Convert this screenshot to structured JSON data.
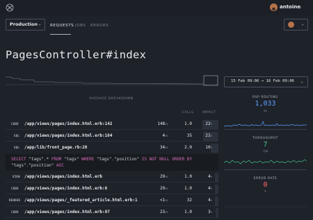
{
  "header": {
    "user_name": "antoine",
    "colors": {
      "bg": "#1c2026",
      "avatar": "#b5734a"
    }
  },
  "environment": {
    "selected": "Production"
  },
  "tabs": [
    {
      "label": "REQUESTS",
      "active": true
    },
    {
      "label": "JOBS",
      "active": false
    },
    {
      "label": "ERRORS",
      "active": false
    }
  ],
  "page_title": "PagesController#index",
  "date_range": {
    "label": "15 Feb 09:06 → 16 Feb 09:06"
  },
  "breakdown": {
    "title": "AVERAGE BREAKDOWN",
    "columns": {
      "calls": "CALLS",
      "impact": "IMPACT"
    },
    "rows": [
      {
        "tag": "CODE",
        "path": "/app/views/pages/index.html.erb:142",
        "time": "148",
        "unit": "ms",
        "calls": "1.0",
        "impact": "22",
        "impact_unit": "%"
      },
      {
        "tag": "SQL",
        "path": "/app/views/pages/index.html.erb:164",
        "time": "4",
        "unit": "ms",
        "calls": "35",
        "impact": "21",
        "impact_unit": "%"
      },
      {
        "tag": "SQL",
        "path": "/app/lib/front_page.rb:20",
        "time": "34",
        "unit": "ms",
        "calls": "2.0",
        "impact": "10",
        "impact_unit": "%"
      },
      {
        "tag": "VIEW",
        "path": "/app/views/pages/index.html.erb",
        "time": "29",
        "unit": "ms",
        "calls": "1.0",
        "impact": "4",
        "impact_unit": "%"
      },
      {
        "tag": "CODE",
        "path": "/app/views/pages/index.html.erb:6",
        "time": "29",
        "unit": "ms",
        "calls": "1.0",
        "impact": "4",
        "impact_unit": "%"
      },
      {
        "tag": "RENDER",
        "path": "/app/views/pages/_featured_article.html.erb:1",
        "time": "<1",
        "unit": "ms",
        "calls": "32",
        "impact": "4",
        "impact_unit": "%"
      },
      {
        "tag": "CODE",
        "path": "/app/views/pages/index.html.erb:87",
        "time": "23",
        "unit": "ms",
        "calls": "1.0",
        "impact": "3",
        "impact_unit": "%"
      }
    ]
  },
  "sql_query": {
    "select": "SELECT",
    "fields": " \"tags\".* ",
    "from": "FROM",
    "table": " \"tags\" ",
    "where": "WHERE",
    "cond": " \"tags\".\"position\" ",
    "is_not_null": "IS NOT NULL",
    "order": " ORDER BY",
    "order_field": "\"tags\".\"position\" ",
    "asc": "ASC"
  },
  "metrics": {
    "rsp_routing": {
      "label": "RSP ROUTING",
      "value": "1,033",
      "unit": "ms",
      "color": "#5aa0ff"
    },
    "throughput": {
      "label": "THROUGHPUT",
      "value": "7",
      "unit": "rpm",
      "color": "#45c48a"
    },
    "error_rate": {
      "label": "ERROR RATE",
      "value": "0",
      "unit": "%",
      "color": "#ff6b6b"
    }
  }
}
